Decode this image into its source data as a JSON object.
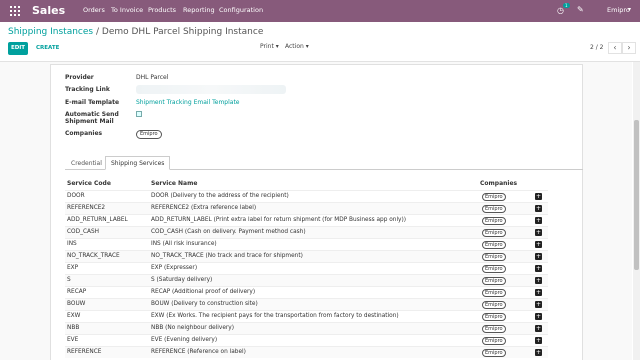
{
  "topbar": {
    "app": "Sales",
    "menu": [
      "Orders",
      "To Invoice",
      "Products",
      "Reporting",
      "Configuration"
    ],
    "notif_count": "1",
    "user": "Emipro",
    "color": "#875a7b"
  },
  "breadcrumb": {
    "parent": "Shipping Instances",
    "sep": "/",
    "current": "Demo DHL Parcel Shipping Instance"
  },
  "controls": {
    "edit": "EDIT",
    "create": "CREATE",
    "print": "Print",
    "action": "Action",
    "pager": "2 / 2",
    "accent": "#00a09d"
  },
  "form": {
    "provider_label": "Provider",
    "provider_value": "DHL Parcel",
    "tracking_label": "Tracking Link",
    "email_label": "E-mail Template",
    "email_value": "Shipment Tracking Email Template",
    "auto_send_label_1": "Automatic Send",
    "auto_send_label_2": "Shipment Mail",
    "companies_label": "Companies",
    "company_tag": "Emipro"
  },
  "tabs": [
    "Credential",
    "Shipping Services"
  ],
  "table": {
    "headers": [
      "Service Code",
      "Service Name",
      "Companies"
    ],
    "rows": [
      {
        "code": "DOOR",
        "name": "DOOR (Delivery to the address of the recipient)",
        "company": "Emipro"
      },
      {
        "code": "REFERENCE2",
        "name": "REFERENCE2 (Extra reference label)",
        "company": "Emipro"
      },
      {
        "code": "ADD_RETURN_LABEL",
        "name": "ADD_RETURN_LABEL (Print extra label for return shipment (for MDP Business app only))",
        "company": "Emipro"
      },
      {
        "code": "COD_CASH",
        "name": "COD_CASH (Cash on delivery. Payment method cash)",
        "company": "Emipro"
      },
      {
        "code": "INS",
        "name": "INS (All risk insurance)",
        "company": "Emipro"
      },
      {
        "code": "NO_TRACK_TRACE",
        "name": "NO_TRACK_TRACE (No track and trace for shipment)",
        "company": "Emipro"
      },
      {
        "code": "EXP",
        "name": "EXP (Expresser)",
        "company": "Emipro"
      },
      {
        "code": "S",
        "name": "S (Saturday delivery)",
        "company": "Emipro"
      },
      {
        "code": "RECAP",
        "name": "RECAP (Additional proof of delivery)",
        "company": "Emipro"
      },
      {
        "code": "BOUW",
        "name": "BOUW (Delivery to construction site)",
        "company": "Emipro"
      },
      {
        "code": "EXW",
        "name": "EXW (Ex Works. The recipient pays for the transportation from factory to destination)",
        "company": "Emipro"
      },
      {
        "code": "NBB",
        "name": "NBB (No neighbour delivery)",
        "company": "Emipro"
      },
      {
        "code": "EVE",
        "name": "EVE (Evening delivery)",
        "company": "Emipro"
      },
      {
        "code": "REFERENCE",
        "name": "REFERENCE (Reference on label)",
        "company": "Emipro"
      }
    ]
  }
}
